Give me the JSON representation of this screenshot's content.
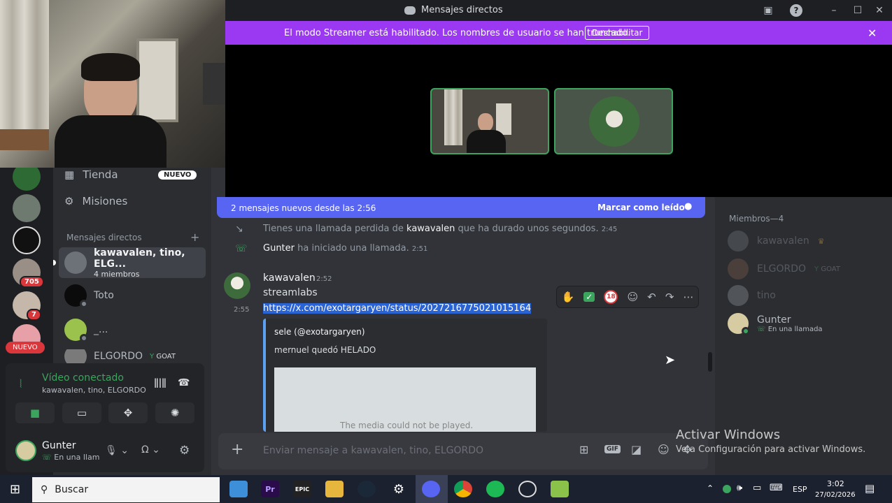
{
  "window": {
    "title": "Mensajes directos"
  },
  "banner": {
    "text": "El modo Streamer está habilitado. Los nombres de usuario se han truncado.",
    "button": "Deshabilitar"
  },
  "guild_badges": {
    "b1": "705",
    "b2": "7",
    "nuevo": "NUEVO"
  },
  "sidebar": {
    "tienda": "Tienda",
    "tienda_badge": "NUEVO",
    "misiones": "Misiones",
    "dm_header": "Mensajes directos",
    "dms": [
      {
        "name": "kawavalen, tino, ELG...",
        "sub": "4 miembros"
      },
      {
        "name": "Toto"
      },
      {
        "name": "_..."
      },
      {
        "name": "ELGORDO",
        "tag": "GOAT"
      }
    ]
  },
  "voice": {
    "status": "Vídeo conectado",
    "channel": "kawavalen, tino, ELGORDO"
  },
  "user": {
    "name": "Gunter",
    "status": "En una llam"
  },
  "chat": {
    "new_messages": "2 mensajes nuevos desde las 2:56",
    "mark_read": "Marcar como leído",
    "sys1": {
      "pre": "Tienes una llamada perdida de ",
      "user": "kawavalen",
      "post": " que ha durado unos segundos.",
      "time": "2:45"
    },
    "sys2": {
      "user": "Gunter",
      "post": " ha iniciado una llamada.",
      "time": "2:51"
    },
    "msg": {
      "author": "kawavalen",
      "time": "2:52",
      "line1": "streamlabs",
      "link": "https://x.com/exotargaryen/status/2027216775021015164",
      "side_time": "2:55"
    },
    "embed": {
      "author": "sele (@exotargaryen)",
      "text": "mernuel quedó HELADO",
      "media": "The media could not be played."
    },
    "reactions": {
      "count": "18"
    },
    "composer_placeholder": "Enviar mensaje a kawavalen, tino, ELGORDO"
  },
  "members": {
    "header": "Miembros—4",
    "list": [
      {
        "name": "kawavalen"
      },
      {
        "name": "ELGORDO",
        "tag": "GOAT"
      },
      {
        "name": "tino"
      },
      {
        "name": "Gunter",
        "sub": "En una llamada"
      }
    ]
  },
  "watermark": {
    "title": "Activar Windows",
    "sub": "Ve a Configuración para activar Windows."
  },
  "taskbar": {
    "search": "Buscar",
    "lang": "ESP",
    "time": "3:02",
    "date": "27/02/2026",
    "app_labels": {
      "premiere": "Pr",
      "epic": "EPIC"
    }
  }
}
